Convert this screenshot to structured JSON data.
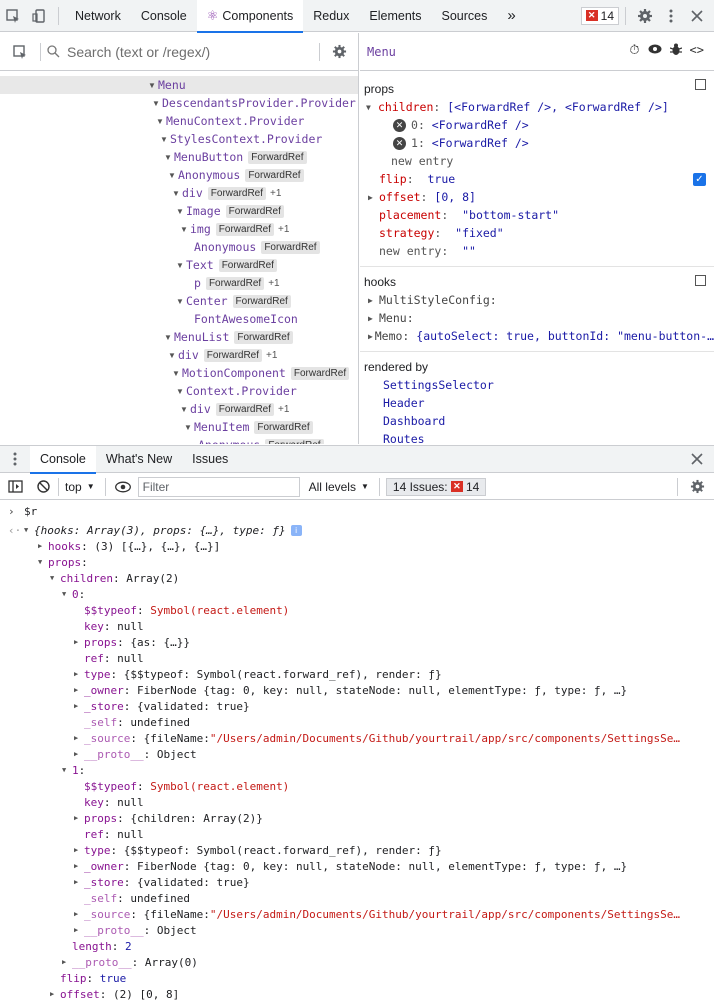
{
  "topbar": {
    "tabs": [
      {
        "label": "Network"
      },
      {
        "label": "Console"
      },
      {
        "label": "Components"
      },
      {
        "label": "Redux"
      },
      {
        "label": "Elements"
      },
      {
        "label": "Sources"
      }
    ],
    "more": "»",
    "issue_count": "14"
  },
  "left": {
    "search_placeholder": "Search (text or /regex/)",
    "tree": [
      {
        "name": "Menu",
        "hoc": "",
        "plus": ""
      },
      {
        "name": "DescendantsProvider.Provider",
        "hoc": "",
        "plus": ""
      },
      {
        "name": "MenuContext.Provider",
        "hoc": "",
        "plus": ""
      },
      {
        "name": "StylesContext.Provider",
        "hoc": "",
        "plus": ""
      },
      {
        "name": "MenuButton",
        "hoc": "ForwardRef",
        "plus": ""
      },
      {
        "name": "Anonymous",
        "hoc": "ForwardRef",
        "plus": ""
      },
      {
        "name": "div",
        "hoc": "ForwardRef",
        "plus": "+1"
      },
      {
        "name": "Image",
        "hoc": "ForwardRef",
        "plus": ""
      },
      {
        "name": "img",
        "hoc": "ForwardRef",
        "plus": "+1"
      },
      {
        "name": "Anonymous",
        "hoc": "ForwardRef",
        "plus": ""
      },
      {
        "name": "Text",
        "hoc": "ForwardRef",
        "plus": ""
      },
      {
        "name": "p",
        "hoc": "ForwardRef",
        "plus": "+1"
      },
      {
        "name": "Center",
        "hoc": "ForwardRef",
        "plus": ""
      },
      {
        "name": "FontAwesomeIcon",
        "hoc": "",
        "plus": ""
      },
      {
        "name": "MenuList",
        "hoc": "ForwardRef",
        "plus": ""
      },
      {
        "name": "div",
        "hoc": "ForwardRef",
        "plus": "+1"
      },
      {
        "name": "MotionComponent",
        "hoc": "ForwardRef",
        "plus": ""
      },
      {
        "name": "Context.Provider",
        "hoc": "",
        "plus": ""
      },
      {
        "name": "div",
        "hoc": "ForwardRef",
        "plus": "+1"
      },
      {
        "name": "MenuItem",
        "hoc": "ForwardRef",
        "plus": ""
      },
      {
        "name": "Anonymous",
        "hoc": "ForwardRef",
        "plus": ""
      }
    ]
  },
  "right": {
    "component_name": "Menu",
    "props_title": "props",
    "children_key": "children",
    "children_val": "[<ForwardRef />, <ForwardRef />]",
    "child0_key": "0",
    "child0_val": "<ForwardRef />",
    "child1_key": "1",
    "child1_val": "<ForwardRef />",
    "new_entry": "new entry",
    "flip_key": "flip",
    "flip_val": "true",
    "offset_key": "offset",
    "offset_val": "[0, 8]",
    "placement_key": "placement",
    "placement_val": "\"bottom-start\"",
    "strategy_key": "strategy",
    "strategy_val": "\"fixed\"",
    "new_entry_key": "new entry",
    "new_entry_val": "\"\"",
    "hooks_title": "hooks",
    "hook1": "MultiStyleConfig:",
    "hook2": "Menu:",
    "hook3_key": "Memo:",
    "hook3_val": "{autoSelect: true, buttonId: \"menu-button-…",
    "rendered_by_title": "rendered by",
    "rendered_by": [
      "SettingsSelector",
      "Header",
      "Dashboard",
      "Routes"
    ]
  },
  "drawer": {
    "tabs": [
      "Console",
      "What's New",
      "Issues"
    ],
    "context": "top",
    "filter_placeholder": "Filter",
    "levels": "All levels",
    "issues_label": "14 Issues:",
    "issues_count": "14"
  },
  "console": {
    "input": "$r",
    "result": "{hooks: Array(3), props: {…}, type: ƒ}",
    "hooks_line": "(3) [{…}, {…}, {…}]",
    "children_line": "Array(2)",
    "typeof_val": "Symbol(react.element)",
    "key_val": "null",
    "props0_val": "{as: {…}}",
    "ref_val": "null",
    "type_val": "{$$typeof: Symbol(react.forward_ref), render: ƒ}",
    "owner_val": "FiberNode {tag: 0, key: null, stateNode: null, elementType: ƒ, type: ƒ, …}",
    "store_val": "{validated: true}",
    "self_val": "undefined",
    "source_prefix": "{fileName: ",
    "source_path": "\"/Users/admin/Documents/Github/yourtrail/app/src/components/SettingsSe…",
    "proto_val": "Object",
    "props1_val": "{children: Array(2)}",
    "length_val": "2",
    "array_proto_val": "Array(0)",
    "flip_val": "true",
    "offset_val": "(2) [0, 8]"
  }
}
